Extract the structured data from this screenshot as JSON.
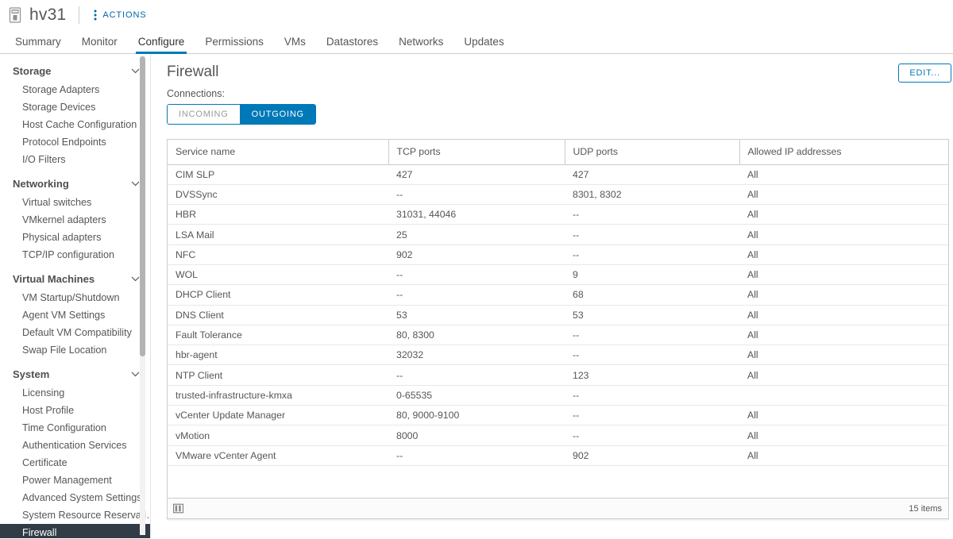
{
  "header": {
    "object_name": "hv31",
    "host_icon": "host-icon",
    "actions_label": "ACTIONS",
    "actions_icon": "kebab-menu-icon"
  },
  "tabs": [
    {
      "label": "Summary",
      "active": false
    },
    {
      "label": "Monitor",
      "active": false
    },
    {
      "label": "Configure",
      "active": true
    },
    {
      "label": "Permissions",
      "active": false
    },
    {
      "label": "VMs",
      "active": false
    },
    {
      "label": "Datastores",
      "active": false
    },
    {
      "label": "Networks",
      "active": false
    },
    {
      "label": "Updates",
      "active": false
    }
  ],
  "sidebar": {
    "groups": [
      {
        "label": "Storage",
        "items": [
          "Storage Adapters",
          "Storage Devices",
          "Host Cache Configuration",
          "Protocol Endpoints",
          "I/O Filters"
        ]
      },
      {
        "label": "Networking",
        "items": [
          "Virtual switches",
          "VMkernel adapters",
          "Physical adapters",
          "TCP/IP configuration"
        ]
      },
      {
        "label": "Virtual Machines",
        "items": [
          "VM Startup/Shutdown",
          "Agent VM Settings",
          "Default VM Compatibility",
          "Swap File Location"
        ]
      },
      {
        "label": "System",
        "items": [
          "Licensing",
          "Host Profile",
          "Time Configuration",
          "Authentication Services",
          "Certificate",
          "Power Management",
          "Advanced System Settings",
          "System Resource Reservati…",
          "Firewall"
        ]
      }
    ],
    "selected": "Firewall"
  },
  "main": {
    "title": "Firewall",
    "edit_button": "EDIT...",
    "connections_label": "Connections:",
    "connection_filters": [
      {
        "label": "INCOMING",
        "active": false
      },
      {
        "label": "OUTGOING",
        "active": true
      }
    ],
    "table": {
      "columns": [
        "Service name",
        "TCP ports",
        "UDP ports",
        "Allowed IP addresses"
      ],
      "rows": [
        [
          "CIM SLP",
          "427",
          "427",
          "All"
        ],
        [
          "DVSSync",
          "--",
          "8301, 8302",
          "All"
        ],
        [
          "HBR",
          "31031, 44046",
          "--",
          "All"
        ],
        [
          "LSA Mail",
          "25",
          "--",
          "All"
        ],
        [
          "NFC",
          "902",
          "--",
          "All"
        ],
        [
          "WOL",
          "--",
          "9",
          "All"
        ],
        [
          "DHCP Client",
          "--",
          "68",
          "All"
        ],
        [
          "DNS Client",
          "53",
          "53",
          "All"
        ],
        [
          "Fault Tolerance",
          "80, 8300",
          "--",
          "All"
        ],
        [
          "hbr-agent",
          "32032",
          "--",
          "All"
        ],
        [
          "NTP Client",
          "--",
          "123",
          "All"
        ],
        [
          "trusted-infrastructure-kmxa",
          "0-65535",
          "--",
          ""
        ],
        [
          "vCenter Update Manager",
          "80, 9000-9100",
          "--",
          "All"
        ],
        [
          "vMotion",
          "8000",
          "--",
          "All"
        ],
        [
          "VMware vCenter Agent",
          "--",
          "902",
          "All"
        ]
      ],
      "footer": {
        "columns_icon": "columns-icon",
        "item_count": "15 items"
      }
    }
  },
  "colors": {
    "accent": "#0079b8",
    "link": "#0065ab",
    "selected_nav_bg": "#313c46",
    "text": "#565656",
    "border": "#cccccc"
  }
}
